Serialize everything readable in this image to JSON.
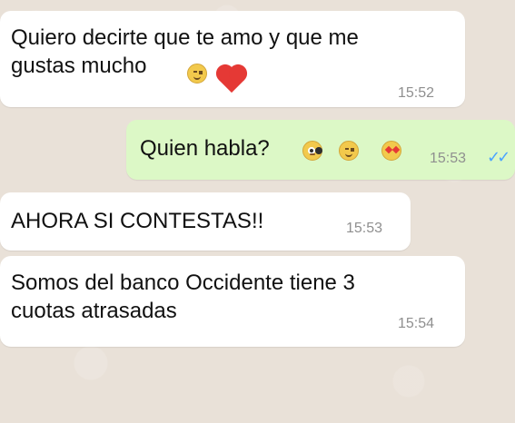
{
  "chat": {
    "messages": [
      {
        "id": "msg1",
        "direction": "incoming",
        "text_line1": "Quiero decirte que te amo y que me",
        "text_line2": "gustas mucho",
        "time": "15:52",
        "emojis": [
          "relieved-smile",
          "red-heart"
        ]
      },
      {
        "id": "msg2",
        "direction": "outgoing",
        "text": "Quien habla?",
        "time": "15:53",
        "status": "✓✓",
        "emojis": [
          "flushed-face",
          "relieved-smile",
          "heart-eyes"
        ]
      },
      {
        "id": "msg3",
        "direction": "incoming",
        "text": "AHORA SI CONTESTAS!!",
        "time": "15:53"
      },
      {
        "id": "msg4",
        "direction": "incoming",
        "text_line1": "Somos del banco Occidente tiene 3",
        "text_line2": "cuotas atrasadas",
        "time": "15:54"
      }
    ]
  },
  "colors": {
    "incoming_bubble": "#ffffff",
    "outgoing_bubble": "#dcf8c6",
    "background": "#e9e1d8",
    "timestamp": "#8f8f8f",
    "read_ticks": "#4aa3ff"
  }
}
